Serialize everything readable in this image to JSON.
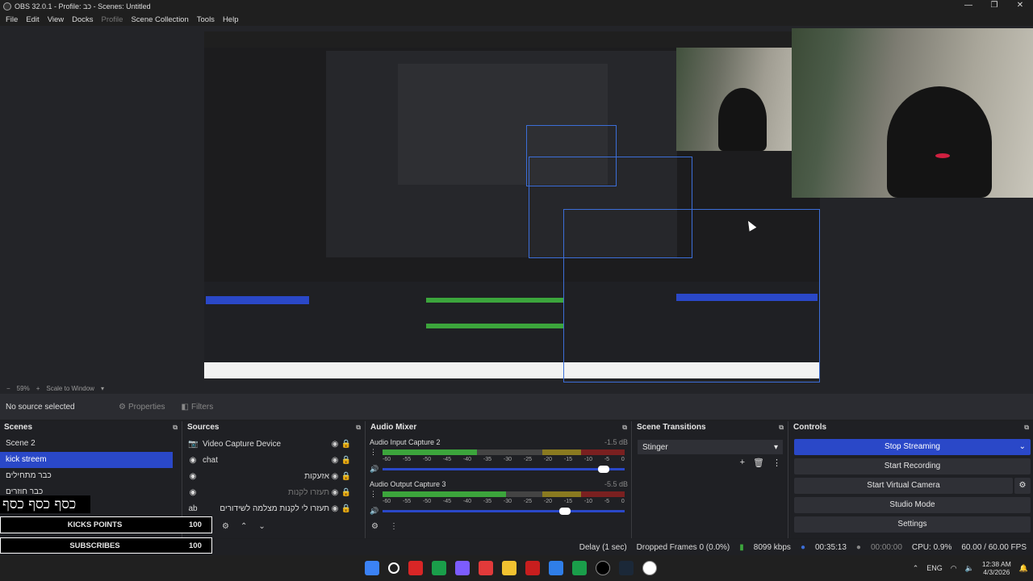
{
  "window": {
    "title": "OBS 32.0.1 - Profile: כב - Scenes: Untitled",
    "controls": [
      "—",
      "❐",
      "✕"
    ]
  },
  "menu": [
    "File",
    "Edit",
    "View",
    "Docks",
    "Profile",
    "Scene Collection",
    "Tools",
    "Help"
  ],
  "preview_bar": {
    "zoom": "59%",
    "scale_mode": "Scale to Window"
  },
  "source_toolbar": {
    "no_source": "No source selected",
    "properties": "Properties",
    "filters": "Filters"
  },
  "scenes": {
    "title": "Scenes",
    "items": [
      "Scene 2",
      "kick streem",
      "כבר מתחילים",
      "כבר חוזרים"
    ],
    "active_index": 1
  },
  "sources": {
    "title": "Sources",
    "items": [
      {
        "icon": "camera-icon",
        "name": "Video Capture Device",
        "rtl": false,
        "dim": false
      },
      {
        "icon": "browser-icon",
        "name": "chat",
        "rtl": false,
        "dim": false
      },
      {
        "icon": "browser-icon",
        "name": "אזעקות",
        "rtl": true,
        "dim": false
      },
      {
        "icon": "browser-icon",
        "name": "תעזרו לקנות",
        "rtl": true,
        "dim": true
      },
      {
        "icon": "text-icon",
        "name": "תעזרו לי לקנות מצלמה לשידורים",
        "rtl": true,
        "dim": false
      }
    ]
  },
  "mixer": {
    "title": "Audio Mixer",
    "channels": [
      {
        "name": "Audio Input Capture 2",
        "db": "-1.5 dB",
        "level": 0.52,
        "volume": 0.92
      },
      {
        "name": "Audio Output Capture 3",
        "db": "-5.5 dB",
        "level": 0.68,
        "volume": 0.76
      }
    ],
    "ticks": [
      "-60",
      "-55",
      "-50",
      "-45",
      "-40",
      "-35",
      "-30",
      "-25",
      "-20",
      "-15",
      "-10",
      "-5",
      "0"
    ]
  },
  "transitions": {
    "title": "Scene Transitions",
    "selected": "Stinger"
  },
  "controls": {
    "title": "Controls",
    "stop_streaming": "Stop Streaming",
    "start_recording": "Start Recording",
    "start_virtual_camera": "Start Virtual Camera",
    "studio_mode": "Studio Mode",
    "settings": "Settings"
  },
  "status": {
    "delay": "Delay (1 sec)",
    "dropped": "Dropped Frames 0 (0.0%)",
    "bitrate": "8099 kbps",
    "stream_time": "00:35:13",
    "rec_time": "00:00:00",
    "cpu": "CPU: 0.9%",
    "fps": "60.00 / 60.00 FPS"
  },
  "overlays": {
    "hebrew_text": "כסף כסף כסף",
    "kicks_label": "KICKS POINTS",
    "kicks_value": "100",
    "subs_label": "SUBSCRIBES",
    "subs_value": "100"
  },
  "taskbar": {
    "lang": "ENG",
    "time": "12:38 AM",
    "date": "4/3/2026",
    "icon_colors": [
      "#3b82f6",
      "#ffffff",
      "#d92626",
      "#1a9e4a",
      "#7c5cff",
      "#e23a3a",
      "#f2c230",
      "#c81e1e",
      "#2f7ee8",
      "#1a9e4a",
      "#000000",
      "#1b2838",
      "#ffffff"
    ]
  }
}
